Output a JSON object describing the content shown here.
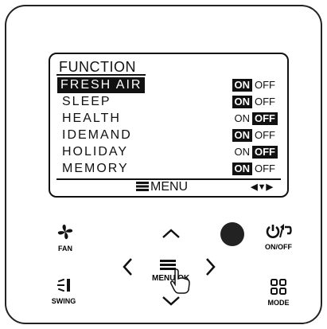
{
  "screen": {
    "title": "FUNCTION",
    "rows": [
      {
        "label": "FRESH AIR",
        "on": "ON",
        "off": "OFF",
        "state": "ON",
        "selected": true
      },
      {
        "label": "SLEEP",
        "on": "ON",
        "off": "OFF",
        "state": "ON",
        "selected": false
      },
      {
        "label": "HEALTH",
        "on": "ON",
        "off": "OFF",
        "state": "OFF",
        "selected": false
      },
      {
        "label": "IDEMAND",
        "on": "ON",
        "off": "OFF",
        "state": "ON",
        "selected": false
      },
      {
        "label": "HOLIDAY",
        "on": "ON",
        "off": "OFF",
        "state": "OFF",
        "selected": false
      },
      {
        "label": "MEMORY",
        "on": "ON",
        "off": "OFF",
        "state": "ON",
        "selected": false
      }
    ],
    "menu_label": "MENU",
    "nav_hint": "◀▼▶"
  },
  "buttons": {
    "fan": "FAN",
    "swing": "SWING",
    "onoff": "ON/OFF",
    "mode": "MODE",
    "menu_ok": "MENU/OK"
  },
  "icons": {
    "fan": "fan-icon",
    "swing": "swing-icon",
    "power": "power-back-icon",
    "mode": "mode-grid-icon",
    "menu": "menu-lines-icon",
    "hand": "hand-pointer-icon"
  }
}
